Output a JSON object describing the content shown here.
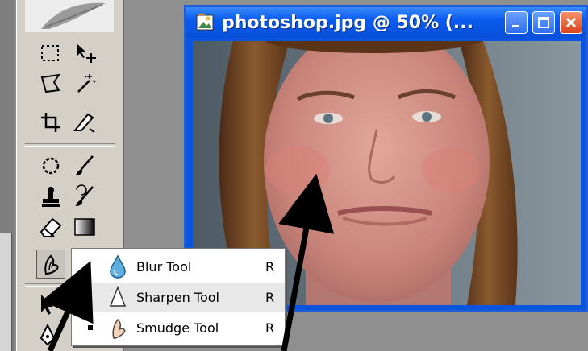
{
  "document": {
    "title": "photoshop.jpg @ 50% (...",
    "minimize_icon": "minimize-icon",
    "maximize_icon": "maximize-icon",
    "close_icon": "close-icon"
  },
  "toolbox": {
    "tools": [
      {
        "name": "rectangular-marquee-tool",
        "icon": "marquee-icon"
      },
      {
        "name": "move-tool",
        "icon": "move-icon"
      },
      {
        "name": "lasso-tool",
        "icon": "lasso-icon"
      },
      {
        "name": "magic-wand-tool",
        "icon": "magic-wand-icon"
      },
      {
        "name": "crop-tool",
        "icon": "crop-icon"
      },
      {
        "name": "slice-tool",
        "icon": "slice-icon"
      },
      {
        "name": "healing-brush-tool",
        "icon": "healing-brush-icon"
      },
      {
        "name": "brush-tool",
        "icon": "brush-icon"
      },
      {
        "name": "clone-stamp-tool",
        "icon": "clone-stamp-icon"
      },
      {
        "name": "history-brush-tool",
        "icon": "history-brush-icon"
      },
      {
        "name": "eraser-tool",
        "icon": "eraser-icon"
      },
      {
        "name": "gradient-tool",
        "icon": "gradient-icon"
      },
      {
        "name": "smudge-tool",
        "icon": "smudge-icon"
      },
      {
        "name": "path-selection-tool",
        "icon": "arrow-icon"
      },
      {
        "name": "pen-tool",
        "icon": "pen-icon"
      }
    ]
  },
  "flyout": {
    "items": [
      {
        "label": "Blur Tool",
        "shortcut": "R",
        "icon": "blur-drop-icon",
        "selected": false
      },
      {
        "label": "Sharpen Tool",
        "shortcut": "R",
        "icon": "sharpen-cone-icon",
        "selected": false
      },
      {
        "label": "Smudge Tool",
        "shortcut": "R",
        "icon": "smudge-finger-icon",
        "selected": true
      }
    ]
  },
  "colors": {
    "titlebar": "#0a5cf0",
    "close_button": "#d8441c",
    "toolbox": "#d4d0c8"
  }
}
